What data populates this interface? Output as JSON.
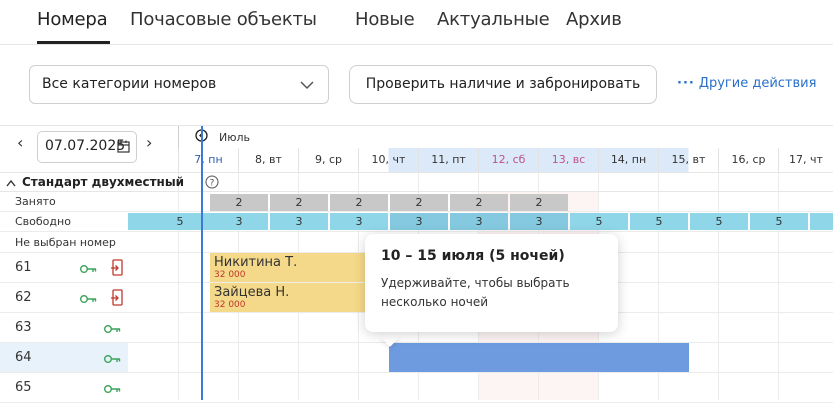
{
  "tabs": [
    {
      "label": "Номера"
    },
    {
      "label": "Почасовые объекты"
    },
    {
      "label": "Новые"
    },
    {
      "label": "Актуальные"
    },
    {
      "label": "Архив"
    }
  ],
  "toolbar": {
    "category_select": "Все категории номеров",
    "check_button": "Проверить наличие и забронировать",
    "more_actions": "Другие действия",
    "more_dots": "···"
  },
  "calendar": {
    "date": "07.07.2025",
    "month": "Июль",
    "days": [
      "7, пн",
      "8, вт",
      "9, ср",
      "10, чт",
      "11, пт",
      "12, сб",
      "13, вс",
      "14, пн",
      "15, вт",
      "16, ср",
      "17, чт"
    ]
  },
  "section": {
    "title": "Стандарт двухместный"
  },
  "rows": {
    "busy_label": "Занято",
    "free_label": "Свободно",
    "unassigned_label": "Не выбран номер",
    "busy_values": [
      "2",
      "2",
      "2",
      "2",
      "2",
      "2"
    ],
    "free_values": [
      "5",
      "3",
      "3",
      "3",
      "3",
      "3",
      "3",
      "5",
      "5",
      "5",
      "5"
    ]
  },
  "rooms": [
    "61",
    "62",
    "63",
    "64",
    "65"
  ],
  "bookings": [
    {
      "name": "Никитина Т.",
      "price": "32 000"
    },
    {
      "name": "Зайцева Н.",
      "price": "32 000"
    }
  ],
  "tooltip": {
    "title": "10 – 15 июля  (5 ночей)",
    "body": "Удерживайте, чтобы выбрать несколько ночей"
  },
  "colors": {
    "accent": "#2a6fc9",
    "free": "#8fd6e8",
    "busy": "#c8c8c8",
    "booking": "#f5d98a",
    "selection": "#6e9be0"
  }
}
